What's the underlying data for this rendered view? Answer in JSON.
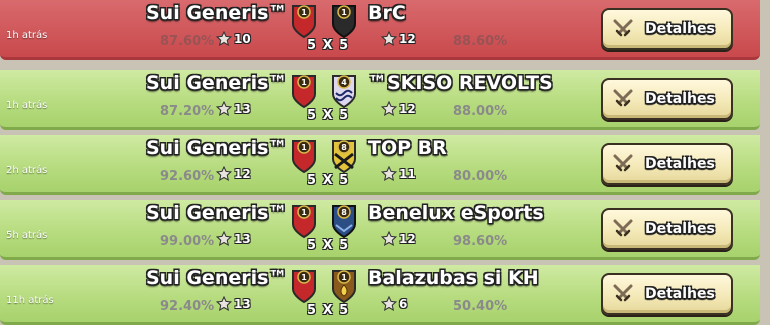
{
  "battle_log": {
    "rows": [
      {
        "result": "loss",
        "time": "1h atrás",
        "clan_left": "Sui Generis™",
        "clan_right": "BrC",
        "left_pct": "87.60%",
        "left_stars": "10",
        "right_stars": "12",
        "right_pct": "88.60%",
        "left_badge_level": "1",
        "right_badge_level": "1",
        "left_badge_color": "#c4282b",
        "right_badge_color": "#2a2a2a",
        "size": "5 X 5",
        "button_label": "Detalhes"
      },
      {
        "result": "win",
        "time": "1h atrás",
        "clan_left": "Sui Generis™",
        "clan_right": "™SKISO REVOLTS",
        "left_pct": "87.20%",
        "left_stars": "13",
        "right_stars": "12",
        "right_pct": "88.00%",
        "left_badge_level": "1",
        "right_badge_level": "4",
        "left_badge_color": "#c4282b",
        "right_badge_color": "#ded8ee",
        "size": "5 X 5",
        "button_label": "Detalhes"
      },
      {
        "result": "win",
        "time": "2h atrás",
        "clan_left": "Sui Generis™",
        "clan_right": "TOP BR",
        "left_pct": "92.60%",
        "left_stars": "12",
        "right_stars": "11",
        "right_pct": "80.00%",
        "left_badge_level": "1",
        "right_badge_level": "8",
        "left_badge_color": "#c4282b",
        "right_badge_color": "#e2c33a",
        "size": "5 X 5",
        "button_label": "Detalhes"
      },
      {
        "result": "win",
        "time": "5h atrás",
        "clan_left": "Sui Generis™",
        "clan_right": "Benelux eSports",
        "left_pct": "99.00%",
        "left_stars": "13",
        "right_stars": "12",
        "right_pct": "98.60%",
        "left_badge_level": "1",
        "right_badge_level": "8",
        "left_badge_color": "#c4282b",
        "right_badge_color": "#2b4f84",
        "size": "5 X 5",
        "button_label": "Detalhes"
      },
      {
        "result": "win",
        "time": "11h atrás",
        "clan_left": "Sui Generis™",
        "clan_right": "Balazubas si KH",
        "left_pct": "92.40%",
        "left_stars": "13",
        "right_stars": "6",
        "right_pct": "50.40%",
        "left_badge_level": "1",
        "right_badge_level": "1",
        "left_badge_color": "#c4282b",
        "right_badge_color": "#8a5a1c",
        "size": "5 X 5",
        "button_label": "Detalhes"
      }
    ]
  },
  "icons": {
    "star": "star-icon",
    "swords": "crossed-swords-icon",
    "badge": "clan-badge-icon"
  }
}
